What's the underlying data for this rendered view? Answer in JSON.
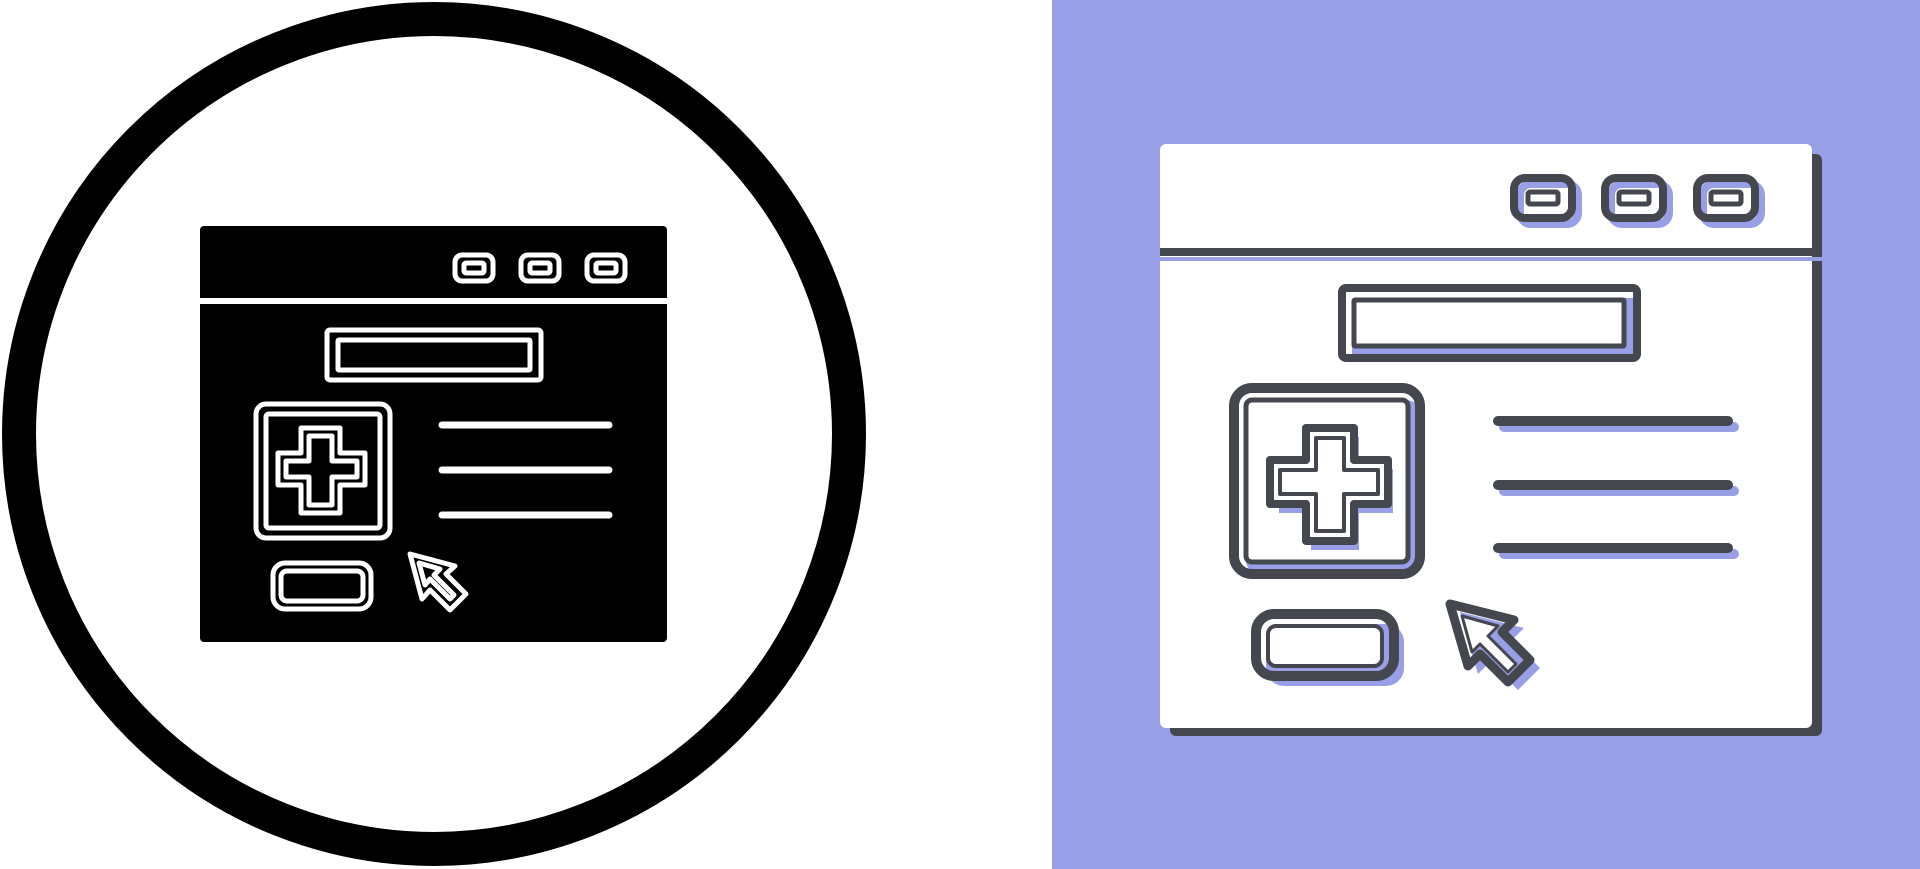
{
  "icons": {
    "left": {
      "icon_name": "medical-website-glyph-icon",
      "style": "glyph",
      "colors": {
        "background": "#ffffff",
        "ring": "#000000",
        "fill": "#000000",
        "stroke": "#ffffff"
      }
    },
    "right": {
      "icon_name": "medical-website-duotone-icon",
      "style": "outline-with-shadow",
      "colors": {
        "background": "#989fe6",
        "window": "#ffffff",
        "stroke": "#45474f",
        "accent": "#989fe6"
      }
    }
  }
}
